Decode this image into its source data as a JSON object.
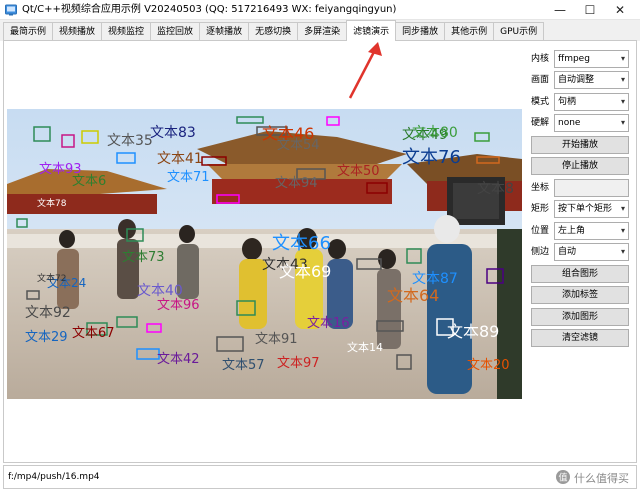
{
  "window": {
    "title": "Qt/C++视频综合应用示例 V20240503 (QQ: 517216493 WX: feiyangqingyun)",
    "controls": {
      "minimize": "—",
      "maximize": "☐",
      "close": "✕"
    }
  },
  "tabs": [
    {
      "label": "最简示例",
      "active": false
    },
    {
      "label": "视频播放",
      "active": false
    },
    {
      "label": "视频监控",
      "active": false
    },
    {
      "label": "监控回放",
      "active": false
    },
    {
      "label": "逐帧播放",
      "active": false
    },
    {
      "label": "无感切换",
      "active": false
    },
    {
      "label": "多屏渲染",
      "active": false
    },
    {
      "label": "滤镜演示",
      "active": true
    },
    {
      "label": "同步播放",
      "active": false
    },
    {
      "label": "其他示例",
      "active": false
    },
    {
      "label": "GPU示例",
      "active": false
    }
  ],
  "panel": {
    "kernel": {
      "label": "内核",
      "value": "ffmpeg"
    },
    "screen": {
      "label": "画面",
      "value": "自动调整"
    },
    "mode": {
      "label": "模式",
      "value": "句柄"
    },
    "hwdecode": {
      "label": "硬解",
      "value": "none"
    },
    "start_button": "开始播放",
    "stop_button": "停止播放",
    "coord": {
      "label": "坐标",
      "value": ""
    },
    "rect": {
      "label": "矩形",
      "value": "按下单个矩形"
    },
    "position": {
      "label": "位置",
      "value": "左上角"
    },
    "border": {
      "label": "侧边",
      "value": "自动"
    },
    "combine_button": "组合图形",
    "add_tag_button": "添加标签",
    "add_shape_button": "添加图形",
    "clear_filter_button": "清空滤镜"
  },
  "path": {
    "value": "f:/mp4/push/16.mp4"
  },
  "watermark": {
    "text": "什么值得买"
  },
  "overlay_labels": [
    {
      "text": "文本83",
      "color": "#1a237e"
    },
    {
      "text": "文本35",
      "color": "#555555"
    },
    {
      "text": "文本41",
      "color": "#8b4513"
    },
    {
      "text": "文本46",
      "color": "#cc3300"
    },
    {
      "text": "文本49",
      "color": "#2a7a2a"
    },
    {
      "text": "文本80",
      "color": "#3a9d3a"
    },
    {
      "text": "文本76",
      "color": "#0b3d91"
    },
    {
      "text": "文本93",
      "color": "#a020f0"
    },
    {
      "text": "文本6",
      "color": "#2f7f2f"
    },
    {
      "text": "文本71",
      "color": "#1e90ff"
    },
    {
      "text": "文本94",
      "color": "#666666"
    },
    {
      "text": "文本50",
      "color": "#aa2222"
    },
    {
      "text": "文本8",
      "color": "#444444"
    },
    {
      "text": "文本78",
      "color": "#ffffff"
    },
    {
      "text": "文本66",
      "color": "#1e90ff"
    },
    {
      "text": "文本43",
      "color": "#2f2f2f"
    },
    {
      "text": "文本69",
      "color": "#ffffff"
    },
    {
      "text": "文本87",
      "color": "#1e90ff"
    },
    {
      "text": "文本24",
      "color": "#1565c0"
    },
    {
      "text": "文本40",
      "color": "#6a5acd"
    },
    {
      "text": "文本92",
      "color": "#4a4a4a"
    },
    {
      "text": "文本64",
      "color": "#d2691e"
    },
    {
      "text": "文本96",
      "color": "#c71585"
    },
    {
      "text": "文本67",
      "color": "#8b0000"
    },
    {
      "text": "文本91",
      "color": "#555555"
    },
    {
      "text": "文本16",
      "color": "#7b1fa2"
    },
    {
      "text": "文本89",
      "color": "#ffffff"
    },
    {
      "text": "文本14",
      "color": "#ffffff"
    },
    {
      "text": "文本42",
      "color": "#6a1b9a"
    },
    {
      "text": "文本57",
      "color": "#2f4f6f"
    },
    {
      "text": "文本97",
      "color": "#cc2222"
    },
    {
      "text": "文本20",
      "color": "#e65100"
    },
    {
      "text": "文本72",
      "color": "#333333"
    },
    {
      "text": "文本54",
      "color": "#666666"
    },
    {
      "text": "文本73",
      "color": "#2e7d32"
    },
    {
      "text": "文本29",
      "color": "#1565c0"
    }
  ]
}
